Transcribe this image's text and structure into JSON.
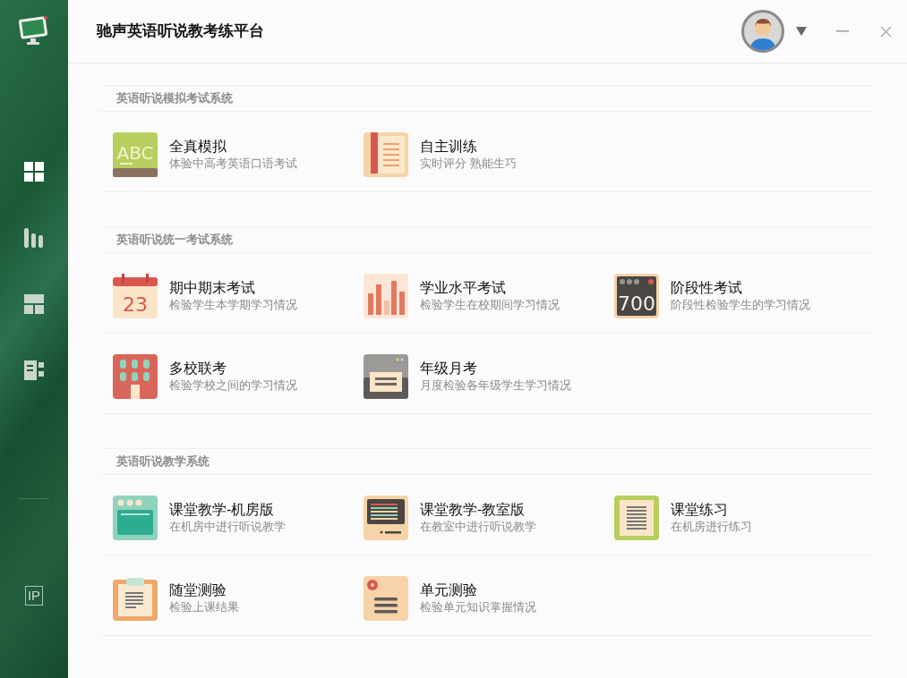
{
  "sidebar": {
    "nav": [
      {
        "kind": "grid",
        "selected": true
      },
      {
        "kind": "bars",
        "selected": false
      },
      {
        "kind": "panels",
        "selected": false
      },
      {
        "kind": "list",
        "selected": false
      }
    ],
    "footer_badge": "IP"
  },
  "header": {
    "title": "驰声英语听说教考练平台"
  },
  "sections": [
    {
      "title": "英语听说模拟考试系统",
      "rows": [
        [
          {
            "kind": "abc",
            "glyph": "ABC",
            "title": "全真模拟",
            "subtitle": "体验中高考英语口语考试"
          },
          {
            "kind": "book",
            "title": "自主训练",
            "subtitle": "实时评分 熟能生巧"
          }
        ]
      ]
    },
    {
      "title": "英语听说统一考试系统",
      "rows": [
        [
          {
            "kind": "calendar",
            "glyph": "23",
            "title": "期中期末考试",
            "subtitle": "检验学生本学期学习情况"
          },
          {
            "kind": "bars",
            "title": "学业水平考试",
            "subtitle": "检验学生在校期间学习情况"
          },
          {
            "kind": "score",
            "glyph": "700",
            "title": "阶段性考试",
            "subtitle": "阶段性检验学生的学习情况"
          }
        ],
        [
          {
            "kind": "building",
            "title": "多校联考",
            "subtitle": "检验学校之间的学习情况"
          },
          {
            "kind": "printer",
            "title": "年级月考",
            "subtitle": "月度检验各年级学生学习情况"
          }
        ]
      ]
    },
    {
      "title": "英语听说教学系统",
      "rows": [
        [
          {
            "kind": "oven",
            "title": "课堂教学-机房版",
            "subtitle": "在机房中进行听说教学"
          },
          {
            "kind": "monitor",
            "title": "课堂教学-教室版",
            "subtitle": "在教室中进行听说教学"
          },
          {
            "kind": "doc",
            "title": "课堂练习",
            "subtitle": "在机房进行练习"
          }
        ],
        [
          {
            "kind": "clipboard",
            "title": "随堂测验",
            "subtitle": "检验上课结果"
          },
          {
            "kind": "note",
            "title": "单元测验",
            "subtitle": "检验单元知识掌握情况"
          }
        ]
      ]
    }
  ]
}
